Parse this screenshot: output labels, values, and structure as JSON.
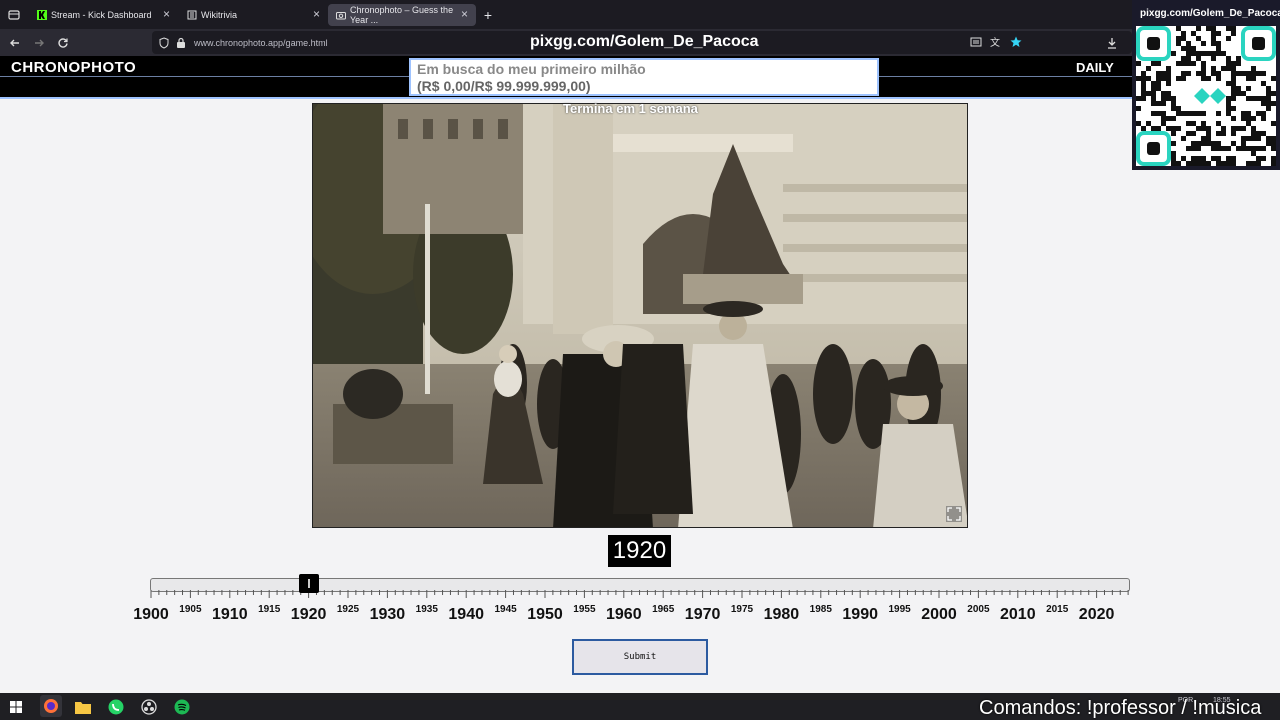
{
  "browser": {
    "tabs": [
      {
        "label": "Stream - Kick Dashboard",
        "icon": "kick-icon"
      },
      {
        "label": "Wikitrivia",
        "icon": "wiki-icon"
      },
      {
        "label": "Chronophoto – Guess the Year ...",
        "icon": "camera-icon",
        "active": true
      }
    ],
    "new_tab_label": "+",
    "url": "www.chronophoto.app/game.html"
  },
  "stream_overlay": {
    "pix_url": "pixgg.com/Golem_De_Pacoca",
    "goal_title": "Em busca do meu primeiro milhão",
    "goal_progress": "(R$ 0,00/R$ 99.999.999,00)",
    "goal_ends": "Termina em 1 semana",
    "qr_label": "pixgg.com/Golem_De_Pacoca",
    "commands": "Comandos: !professor / !musica"
  },
  "site": {
    "logo": "CHRONOPHOTO",
    "daily": "DAILY"
  },
  "game": {
    "selected_year": "1920",
    "slider_min": 1900,
    "slider_max": 2024,
    "slider_value": 1920,
    "submit_label": "Submit",
    "major_years": [
      "1900",
      "1910",
      "1920",
      "1930",
      "1940",
      "1950",
      "1960",
      "1970",
      "1980",
      "1990",
      "2000",
      "2010",
      "2020"
    ],
    "minor_years": [
      "1905",
      "1915",
      "1925",
      "1935",
      "1945",
      "1955",
      "1965",
      "1975",
      "1985",
      "1995",
      "2005",
      "2015"
    ]
  },
  "taskbar": {
    "lang": "POR",
    "time": "18:55"
  },
  "colors": {
    "accent": "#2c5aa0",
    "header_bg": "#000000",
    "qr_teal": "#2ad4c0"
  }
}
